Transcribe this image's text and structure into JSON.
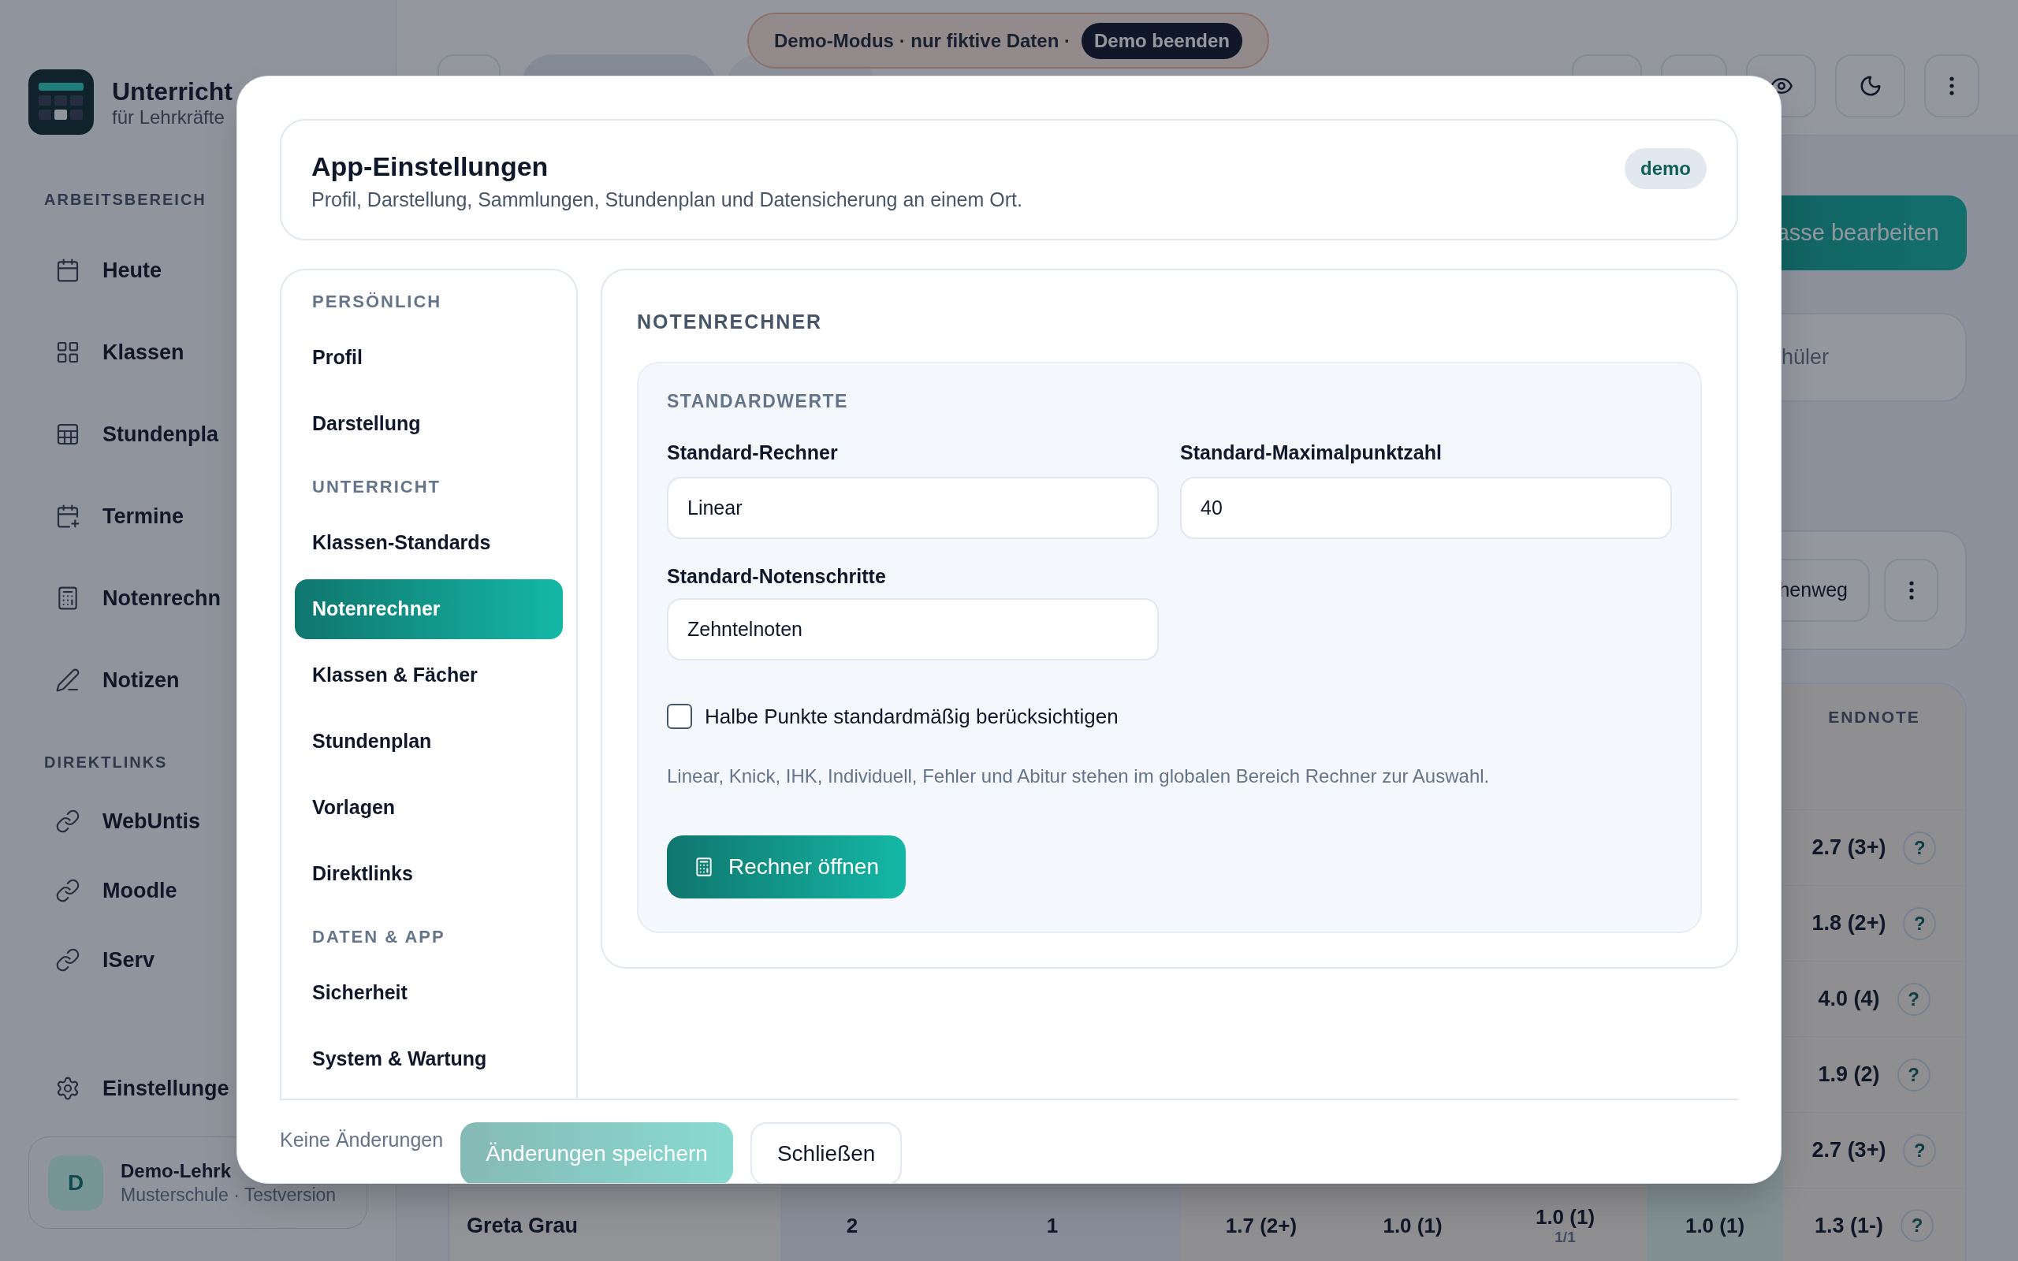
{
  "sidebar": {
    "brand": {
      "title": "Unterricht",
      "subtitle": "für Lehrkräfte"
    },
    "sections": [
      {
        "title": "ARBEITSBEREICH",
        "items": [
          {
            "label": "Heute",
            "kind": "calendar"
          },
          {
            "label": "Klassen",
            "kind": "grid"
          },
          {
            "label": "Stundenpla",
            "kind": "table"
          },
          {
            "label": "Termine",
            "kind": "event"
          },
          {
            "label": "Notenrechn",
            "kind": "calculator"
          },
          {
            "label": "Notizen",
            "kind": "note"
          }
        ]
      },
      {
        "title": "DIREKTLINKS",
        "items": [
          {
            "label": "WebUntis",
            "kind": "link"
          },
          {
            "label": "Moodle",
            "kind": "link"
          },
          {
            "label": "IServ",
            "kind": "link"
          }
        ]
      }
    ],
    "settings": "Einstellunge",
    "user": {
      "initial": "D",
      "name": "Demo-Lehrk",
      "school": "Musterschule · Testversion"
    }
  },
  "demo_banner": {
    "text": "Demo-Modus · nur fiktive Daten ·",
    "button": "Demo beenden"
  },
  "main": {
    "edit_button": "asse bearbeiten",
    "search": {
      "placeholder": "hüler"
    },
    "toolbar_button": "henweg",
    "table": {
      "columns": [
        "ENDNOTE"
      ],
      "rows": [
        {
          "endnote": "2.7 (3+)",
          "help": "?"
        },
        {
          "endnote": "1.8 (2+)",
          "help": "?"
        },
        {
          "endnote": "4.0 (4)",
          "help": "?"
        },
        {
          "endnote": "1.9 (2)",
          "help": "?"
        },
        {
          "endnote": "2.7 (3+)",
          "help": "?"
        },
        {
          "cells": [
            {
              "text": "Greta Grau"
            },
            {
              "text": "2"
            },
            {
              "text": "1"
            },
            {
              "text": "1.7 (2+)"
            },
            {
              "text": "1.0 (1)"
            },
            {
              "text": "1.0 (1)",
              "sub": "1/1"
            },
            {
              "text": "1.0 (1)"
            }
          ],
          "endnote": "1.3 (1-)",
          "help": "?"
        }
      ]
    }
  },
  "dialog": {
    "title": "App-Einstellungen",
    "subtitle": "Profil, Darstellung, Sammlungen, Stundenplan und Datensicherung an einem Ort.",
    "badge": "demo",
    "nav": [
      {
        "title": "PERSÖNLICH",
        "items": [
          {
            "label": "Profil",
            "selected": false
          },
          {
            "label": "Darstellung",
            "selected": false
          }
        ]
      },
      {
        "title": "UNTERRICHT",
        "items": [
          {
            "label": "Klassen-Standards",
            "selected": false
          },
          {
            "label": "Notenrechner",
            "selected": true
          },
          {
            "label": "Klassen & Fächer",
            "selected": false
          },
          {
            "label": "Stundenplan",
            "selected": false
          },
          {
            "label": "Vorlagen",
            "selected": false
          },
          {
            "label": "Direktlinks",
            "selected": false
          }
        ]
      },
      {
        "title": "DATEN & APP",
        "items": [
          {
            "label": "Sicherheit",
            "selected": false
          },
          {
            "label": "System & Wartung",
            "selected": false
          }
        ]
      }
    ],
    "panel": {
      "title": "NOTENRECHNER",
      "group": {
        "title": "STANDARDWERTE",
        "fields": [
          {
            "label": "Standard-Rechner",
            "value": "Linear"
          },
          {
            "label": "Standard-Maximalpunktzahl",
            "value": "40"
          },
          {
            "label": "Standard-Notenschritte",
            "value": "Zehntelnoten"
          }
        ],
        "checkbox": {
          "label": "Halbe Punkte standardmäßig berücksichtigen",
          "checked": false
        },
        "hint": "Linear, Knick, IHK, Individuell, Fehler und Abitur stehen im globalen Bereich Rechner zur Auswahl.",
        "button": "Rechner öffnen"
      }
    },
    "footer": {
      "status": "Keine Änderungen",
      "save": {
        "label": "Änderungen speichern",
        "disabled": true
      },
      "close": "Schließen"
    }
  }
}
